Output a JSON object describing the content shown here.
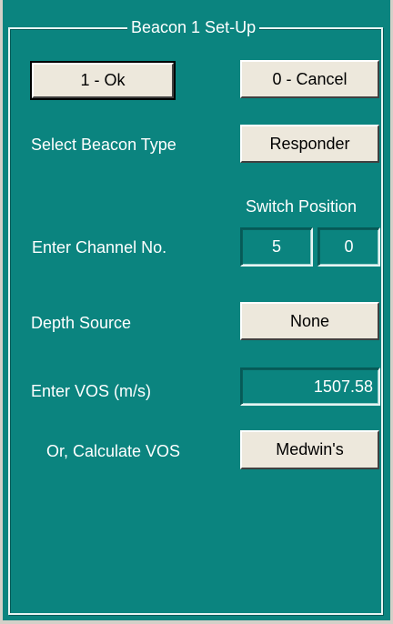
{
  "dialog": {
    "title": "Beacon 1 Set-Up",
    "ok_button": "1 - Ok",
    "cancel_button": "0 - Cancel"
  },
  "beacon_type": {
    "label": "Select Beacon Type",
    "value": "Responder"
  },
  "switch_position": {
    "heading": "Switch Position"
  },
  "channel": {
    "label": "Enter Channel No.",
    "digit1": "5",
    "digit2": "0"
  },
  "depth_source": {
    "label": "Depth Source",
    "value": "None"
  },
  "vos": {
    "label": "Enter VOS (m/s)",
    "value": "1507.58"
  },
  "calc_vos": {
    "label": "Or, Calculate VOS",
    "value": "Medwin's"
  }
}
